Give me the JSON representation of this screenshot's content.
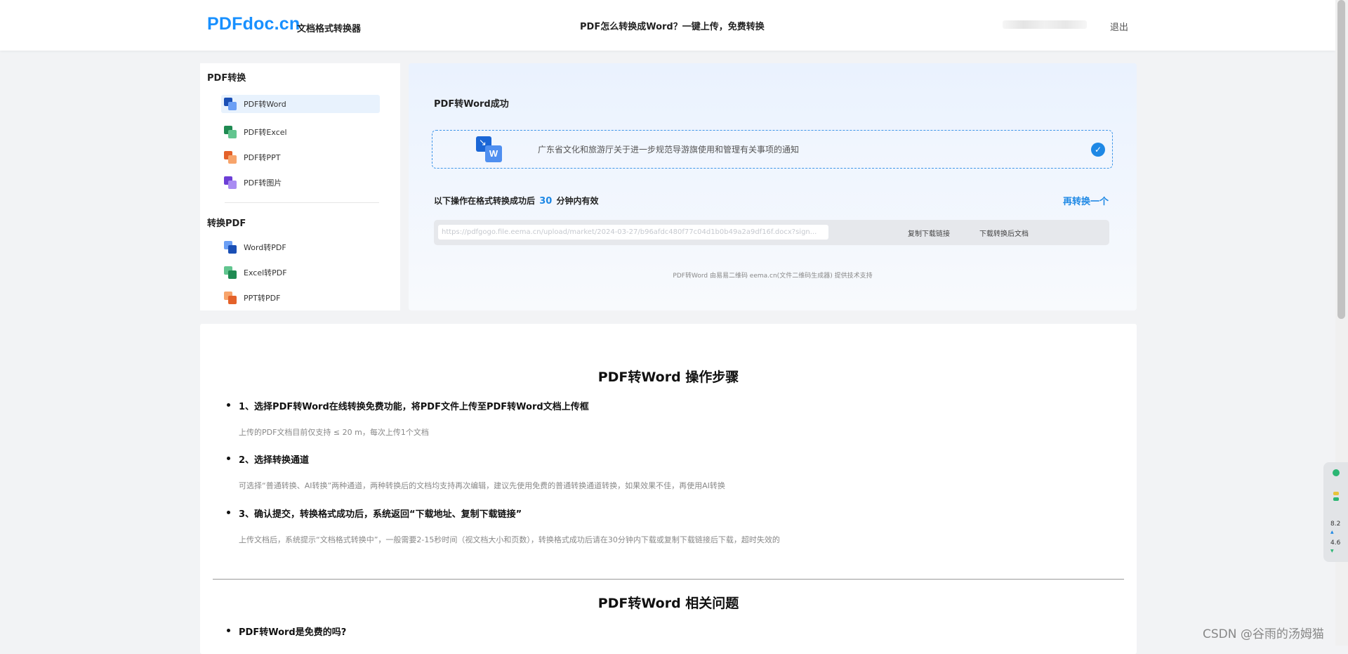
{
  "header": {
    "logo": "PDFdoc.cn",
    "logo_sub": "文档格式转换器",
    "title": "PDF怎么转换成Word？一键上传，免费转换",
    "logout": "退出"
  },
  "sidebar": {
    "groups": [
      {
        "title": "PDF转换",
        "items": [
          {
            "label": "PDF转Word",
            "icon": "pdf-to-word-icon",
            "color": "#2f6fe4",
            "active": true
          },
          {
            "label": "PDF转Excel",
            "icon": "pdf-to-excel-icon",
            "color": "#2ea869",
            "active": false
          },
          {
            "label": "PDF转PPT",
            "icon": "pdf-to-ppt-icon",
            "color": "#f07b37",
            "active": false
          },
          {
            "label": "PDF转图片",
            "icon": "pdf-to-image-icon",
            "color": "#8b5cf6",
            "active": false
          }
        ]
      },
      {
        "title": "转换PDF",
        "items": [
          {
            "label": "Word转PDF",
            "icon": "word-to-pdf-icon",
            "color": "#2f6fe4",
            "active": false
          },
          {
            "label": "Excel转PDF",
            "icon": "excel-to-pdf-icon",
            "color": "#2ea869",
            "active": false
          },
          {
            "label": "PPT转PDF",
            "icon": "ppt-to-pdf-icon",
            "color": "#f07b37",
            "active": false
          }
        ]
      }
    ]
  },
  "result": {
    "title": "PDF转Word成功",
    "file_name": "广东省文化和旅游厅关于进一步规范导游旗使用和管理有关事项的通知",
    "valid_prefix": "以下操作在格式转换成功后",
    "valid_minutes": "30",
    "valid_suffix": "分钟内有效",
    "reconvert": "再转换一个",
    "link_value": "https://pdfgogo.file.eema.cn/upload/market/2024-03-27/b96afdc480f77c04d1b0b49a2a9df16f.docx?sign...",
    "copy_link": "复制下载链接",
    "download": "下载转换后文档",
    "support": "PDF转Word 由易易二维码 eema.cn(文件二维码生成器) 提供技术支持"
  },
  "article": {
    "steps_title": "PDF转Word 操作步骤",
    "steps": [
      {
        "title": "1、选择PDF转Word在线转换免费功能，将PDF文件上传至PDF转Word文档上传框",
        "desc": "上传的PDF文档目前仅支持 ≤ 20 m，每次上传1个文档"
      },
      {
        "title": "2、选择转换通道",
        "desc": "可选择“普通转换、AI转换”两种通道，两种转换后的文档均支持再次编辑，建议先使用免费的普通转换通道转换，如果效果不佳，再使用AI转换"
      },
      {
        "title": "3、确认提交，转换格式成功后，系统返回“下载地址、复制下载链接”",
        "desc": "上传文档后，系统提示“文档格式转换中”，一般需要2-15秒时间（视文档大小和页数），转换格式成功后请在30分钟内下载或复制下载链接后下载，超时失效的"
      }
    ],
    "faq_title": "PDF转Word 相关问题",
    "faq_first": "PDF转Word是免费的吗?"
  },
  "widget": {
    "value1": "8.2",
    "value2": "4.6"
  },
  "watermark": "CSDN @谷雨的汤姆猫"
}
